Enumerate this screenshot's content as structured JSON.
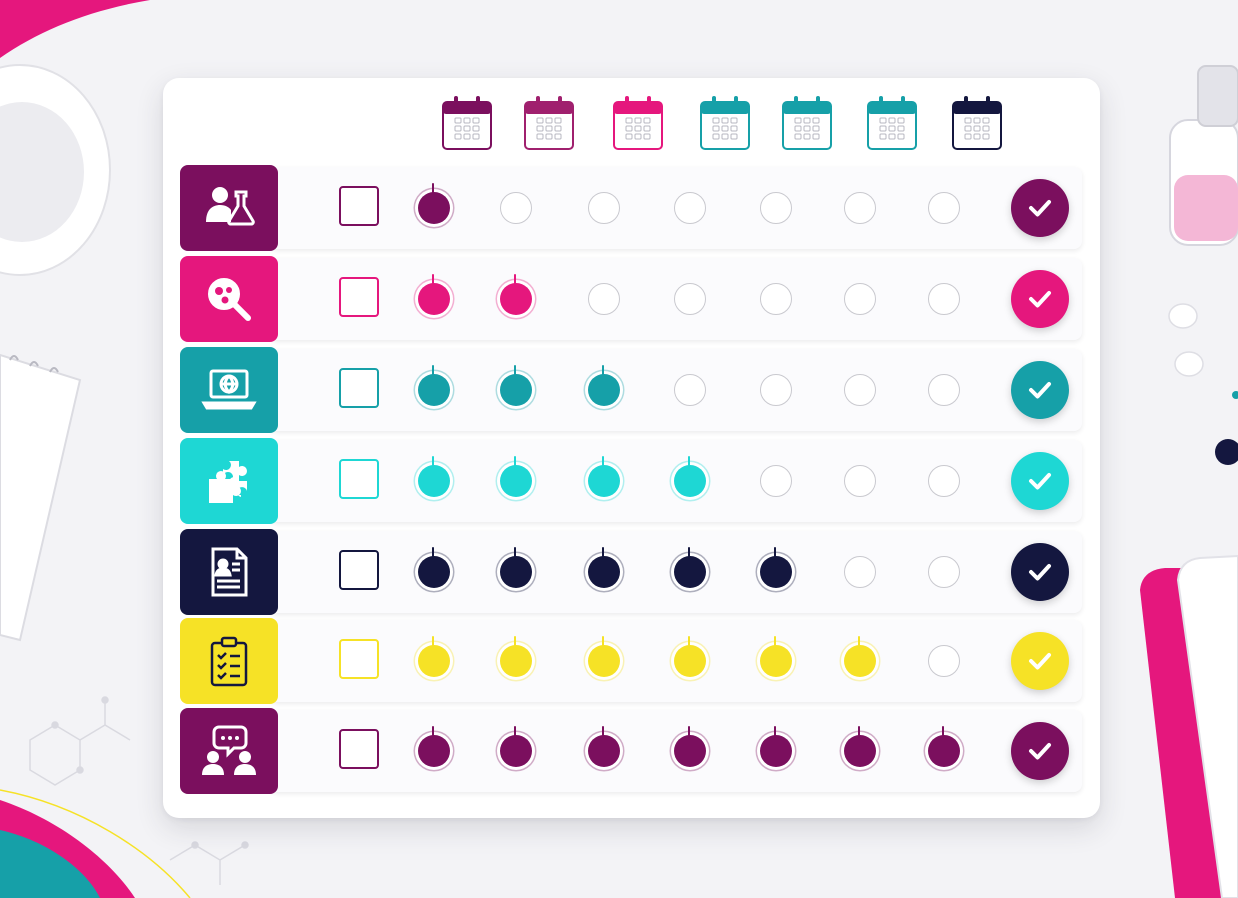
{
  "colors": {
    "plum": "#7b0f5e",
    "magenta": "#e5177d",
    "teal": "#16a0a8",
    "cyan": "#1ed7d4",
    "navy": "#14173f",
    "yellow": "#f6e226",
    "background": "#f3f3f6"
  },
  "calendar_icons": [
    {
      "icon": "calendar-icon",
      "color": "#7b0f5e"
    },
    {
      "icon": "calendar-icon",
      "color": "#a0206e"
    },
    {
      "icon": "calendar-icon",
      "color": "#e5177d"
    },
    {
      "icon": "calendar-icon",
      "color": "#16a0a8"
    },
    {
      "icon": "calendar-icon",
      "color": "#16a0a8"
    },
    {
      "icon": "calendar-icon",
      "color": "#16a0a8"
    },
    {
      "icon": "calendar-icon",
      "color": "#14173f"
    }
  ],
  "rows": [
    {
      "icon": "researcher-flask-icon",
      "color": "#7b0f5e",
      "checked_box": false,
      "filled": 1,
      "total": 7,
      "complete": true
    },
    {
      "icon": "magnifier-cells-icon",
      "color": "#e5177d",
      "checked_box": false,
      "filled": 2,
      "total": 7,
      "complete": true
    },
    {
      "icon": "laptop-globe-icon",
      "color": "#16a0a8",
      "checked_box": false,
      "filled": 3,
      "total": 7,
      "complete": true
    },
    {
      "icon": "puzzle-icon",
      "color": "#1ed7d4",
      "checked_box": false,
      "filled": 4,
      "total": 7,
      "complete": true
    },
    {
      "icon": "profile-document-icon",
      "color": "#14173f",
      "checked_box": false,
      "filled": 5,
      "total": 7,
      "complete": true
    },
    {
      "icon": "clipboard-checklist-icon",
      "color": "#f6e226",
      "checked_box": false,
      "filled": 6,
      "total": 7,
      "complete": true
    },
    {
      "icon": "team-chat-icon",
      "color": "#7b0f5e",
      "checked_box": false,
      "filled": 7,
      "total": 7,
      "complete": true
    }
  ]
}
